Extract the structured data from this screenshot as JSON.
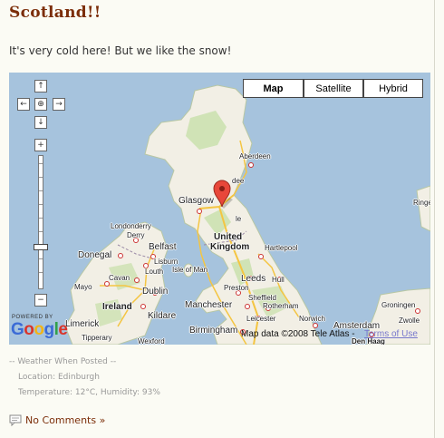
{
  "post": {
    "title": "Scotland!!",
    "text": "It's very cold here! But we like the snow!"
  },
  "map": {
    "type_buttons": [
      "Map",
      "Satellite",
      "Hybrid"
    ],
    "active_type": "Map",
    "controls": {
      "pan_up": "↑",
      "pan_left": "←",
      "pan_center": "⊕",
      "pan_right": "→",
      "pan_down": "↓",
      "zoom_in": "+",
      "zoom_out": "−"
    },
    "labels": {
      "aberdeen": "Aberdeen",
      "dundee": "dee",
      "glasgow": "Glasgow",
      "united_kingdom_1": "United",
      "united_kingdom_2": "Kingdom",
      "londonderry": "Londonderry",
      "derry": "Derry",
      "donegal": "Donegal",
      "belfast": "Belfast",
      "lisburn": "Lisburn",
      "louth": "Louth",
      "cavan": "Cavan",
      "mayo": "Mayo",
      "dublin": "Dublin",
      "kildare": "Kildare",
      "ireland": "Ireland",
      "limerick": "Limerick",
      "tipperary": "Tipperary",
      "wexford": "Wexford",
      "isle_of_man": "Isle of Man",
      "newcastle": "le",
      "hartlepool": "Hartlepool",
      "leeds": "Leeds",
      "hull": "Hull",
      "preston": "Preston",
      "manchester": "Manchester",
      "sheffield": "Sheffield",
      "rotherham": "Rotherham",
      "birmingham": "Birmingham",
      "leicester": "Leicester",
      "norwich": "Norwich",
      "amsterdam": "Amsterdam",
      "groningen": "Groningen",
      "zwolle": "Zwolle",
      "den_haag": "Den Haag",
      "ringe": "Ringe"
    },
    "powered_by": "POWERED BY",
    "google_letters": [
      "G",
      "o",
      "o",
      "g",
      "l",
      "e"
    ],
    "google_colors": [
      "#3b6bd6",
      "#d9352a",
      "#f2b416",
      "#3b6bd6",
      "#31a14c",
      "#d9352a"
    ],
    "attribution": "Map data ©2008 Tele Atlas -",
    "terms": "Terms of Use",
    "marker": {
      "location": "Edinburgh",
      "color": "#e8473a"
    }
  },
  "weather": {
    "heading": "-- Weather When Posted --",
    "location": "Location: Edinburgh",
    "conditions": "Temperature: 12°C, Humidity: 93%"
  },
  "comments": {
    "link_text": "No Comments »",
    "icon": "comment-bubble-icon"
  },
  "colors": {
    "title": "#7b2d08",
    "sea": "#a6c3dd",
    "land": "#f2efe5",
    "park": "#c7e0aa"
  }
}
